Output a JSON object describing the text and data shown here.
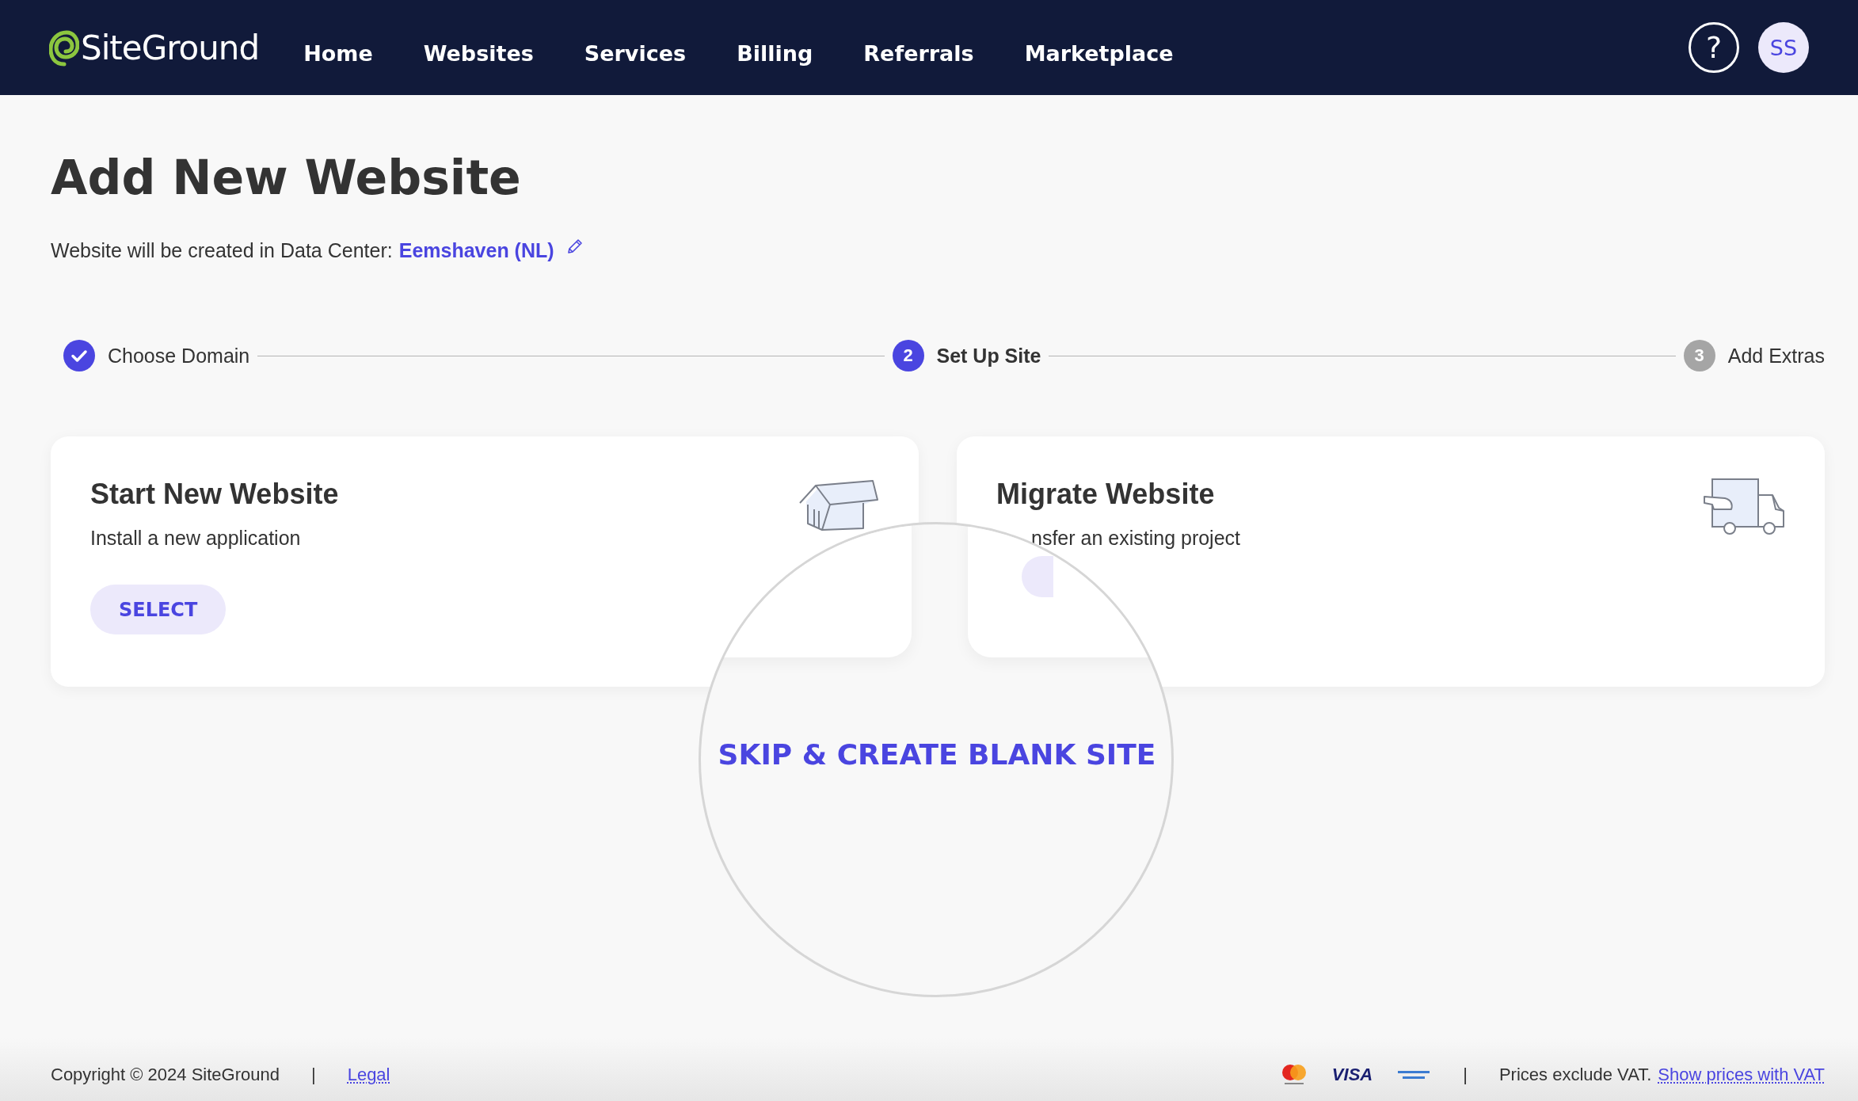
{
  "header": {
    "logo": "SiteGround",
    "nav": [
      {
        "label": "Home"
      },
      {
        "label": "Websites"
      },
      {
        "label": "Services"
      },
      {
        "label": "Billing"
      },
      {
        "label": "Referrals"
      },
      {
        "label": "Marketplace"
      }
    ],
    "help": "?",
    "avatar": "SS"
  },
  "page": {
    "title": "Add New Website",
    "datacenter_label": "Website will be created in Data Center:",
    "datacenter": "Eemshaven (NL)"
  },
  "steps": [
    {
      "label": "Choose Domain",
      "kind": "done"
    },
    {
      "label": "Set Up Site",
      "number": "2",
      "kind": "current"
    },
    {
      "label": "Add Extras",
      "number": "3",
      "kind": "upcoming"
    }
  ],
  "cards": [
    {
      "title": "Start New Website",
      "description": "Install a new application",
      "button": "SELECT",
      "kind": "house"
    },
    {
      "title": "Migrate Website",
      "description": "nsfer an existing project",
      "kind": "truck"
    }
  ],
  "magnifier": {
    "link": "SKIP & CREATE BLANK SITE"
  },
  "footer": {
    "copyright": "Copyright © 2024 SiteGround",
    "separator": "|",
    "legal": "Legal",
    "visa": "VISA",
    "separator_2": "|",
    "vat_note": "Prices exclude VAT.",
    "vat_link": "Show prices with VAT"
  }
}
